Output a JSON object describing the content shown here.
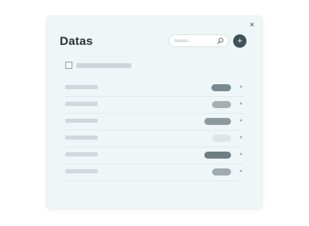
{
  "dialog": {
    "title": "Datas",
    "close_glyph": "×",
    "search": {
      "placeholder": "Search",
      "value": ""
    },
    "add_glyph": "+",
    "remove_glyph": "×",
    "icons": [
      "close-icon",
      "search-icon",
      "plus-icon",
      "remove-icon",
      "checkbox-icon"
    ],
    "colors": {
      "background": "#eef6f8",
      "accent": "#3e5358",
      "text": "#2f3437"
    },
    "rows": [
      {
        "pill_color": "#778a8f"
      },
      {
        "pill_color": "#a5b0b3"
      },
      {
        "pill_color": "#8c9a9e"
      },
      {
        "pill_color": "#dde5e7"
      },
      {
        "pill_color": "#6e7f84"
      },
      {
        "pill_color": "#9fabae"
      }
    ]
  }
}
